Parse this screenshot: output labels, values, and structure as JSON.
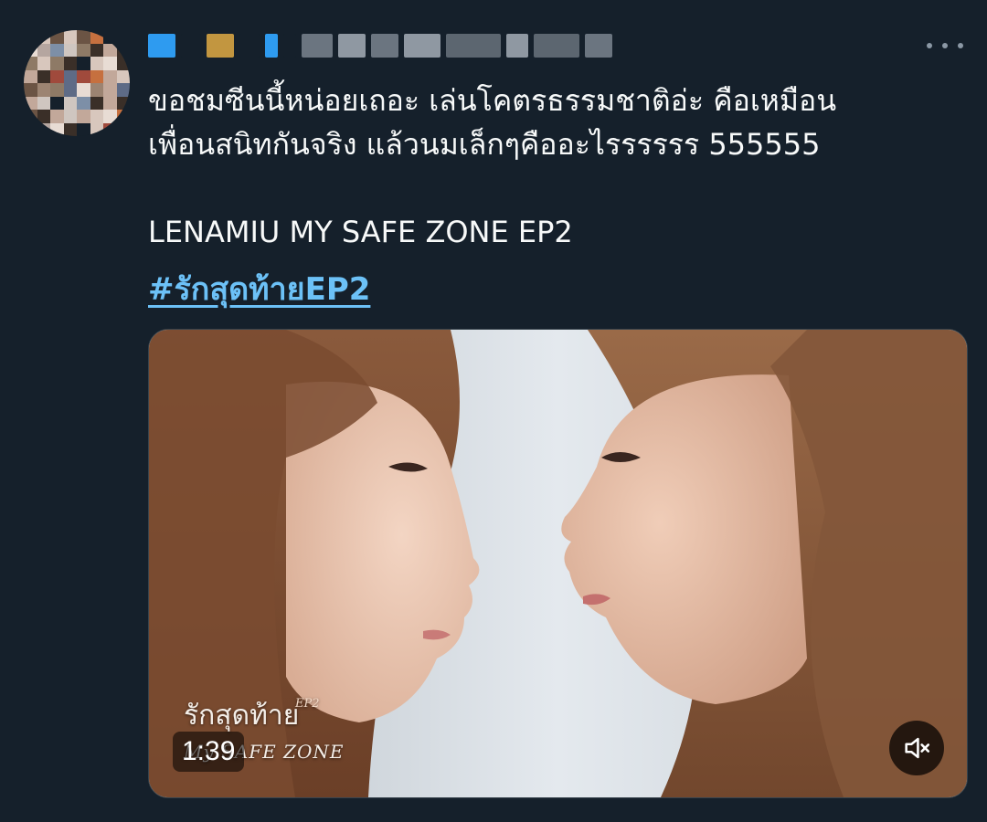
{
  "tweet": {
    "text": "ขอชมซีนนี้หน่อยเถอะ เล่นโคตรธรรมชาติอ่ะ คือเหมือน\nเพื่อนสนิทกันจริง แล้วนมเล็กๆคืออะไรรรรรร  555555\n\nLENAMIU MY SAFE ZONE EP2",
    "hashtag": "#รักสุดท้ายEP2"
  },
  "video": {
    "timestamp": "1:39",
    "watermark_title": "รักสุดท้าย",
    "watermark_ep": "EP2",
    "watermark_sub": "My SAFE ZONE",
    "muted": true
  },
  "icons": {
    "more": "more-horizontal-icon",
    "mute": "volume-muted-icon"
  },
  "colors": {
    "background": "#15202b",
    "text": "#f7f9f9",
    "link": "#6cc1f7",
    "icon": "#8b98a5"
  }
}
